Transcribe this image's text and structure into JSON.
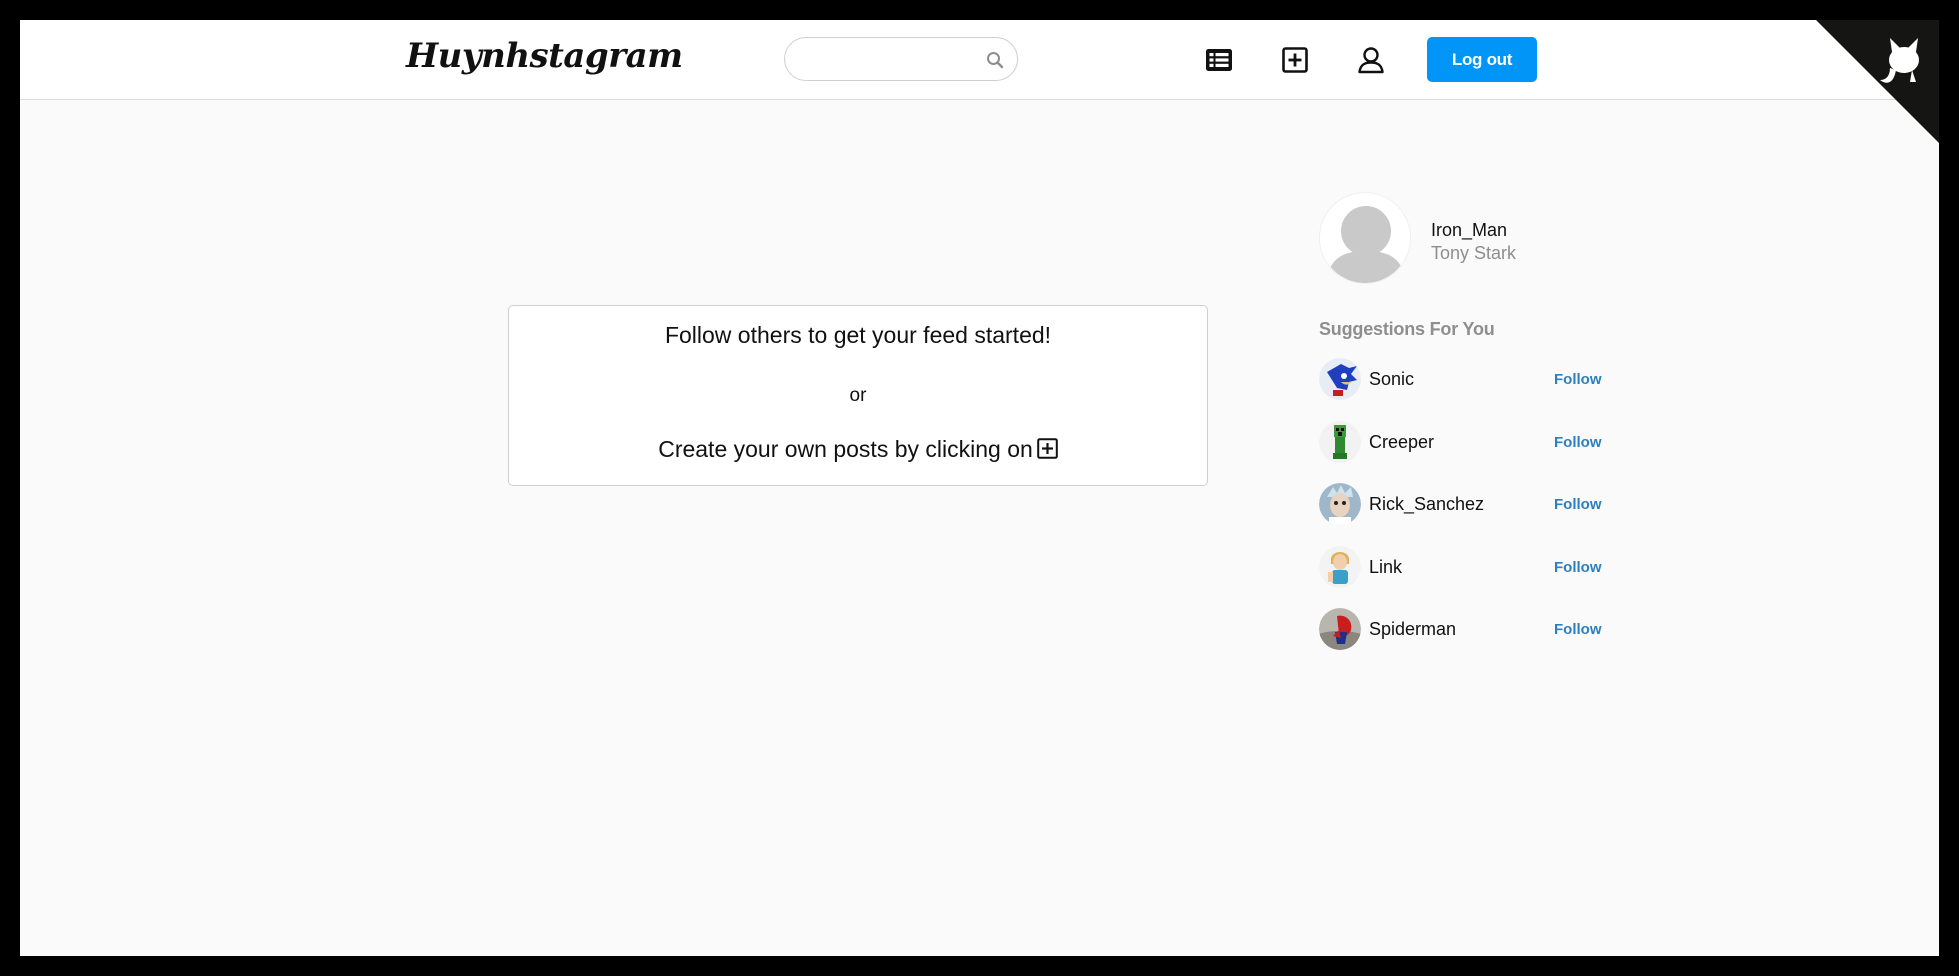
{
  "header": {
    "logo": "Huynhstagram",
    "search": {
      "value": "",
      "placeholder": ""
    },
    "logout_label": "Log out",
    "icons": [
      "feed-list-icon",
      "new-post-icon",
      "profile-icon",
      "github-corner-icon"
    ]
  },
  "feed": {
    "empty_line1": "Follow others to get your feed started!",
    "empty_or": "or",
    "empty_line3": "Create your own posts by clicking on"
  },
  "profile": {
    "username": "Iron_Man",
    "full_name": "Tony Stark"
  },
  "suggestions": {
    "title": "Suggestions For You",
    "follow_label": "Follow",
    "users": [
      {
        "name": "Sonic",
        "avatar": "sonic-avatar"
      },
      {
        "name": "Creeper",
        "avatar": "creeper-avatar"
      },
      {
        "name": "Rick_Sanchez",
        "avatar": "rick-avatar"
      },
      {
        "name": "Link",
        "avatar": "link-avatar"
      },
      {
        "name": "Spiderman",
        "avatar": "spiderman-avatar"
      }
    ]
  },
  "colors": {
    "accent": "#0095f6",
    "follow_link": "#2c7fc0",
    "page_bg": "#fafafa",
    "muted_text": "#8e8e8e"
  }
}
